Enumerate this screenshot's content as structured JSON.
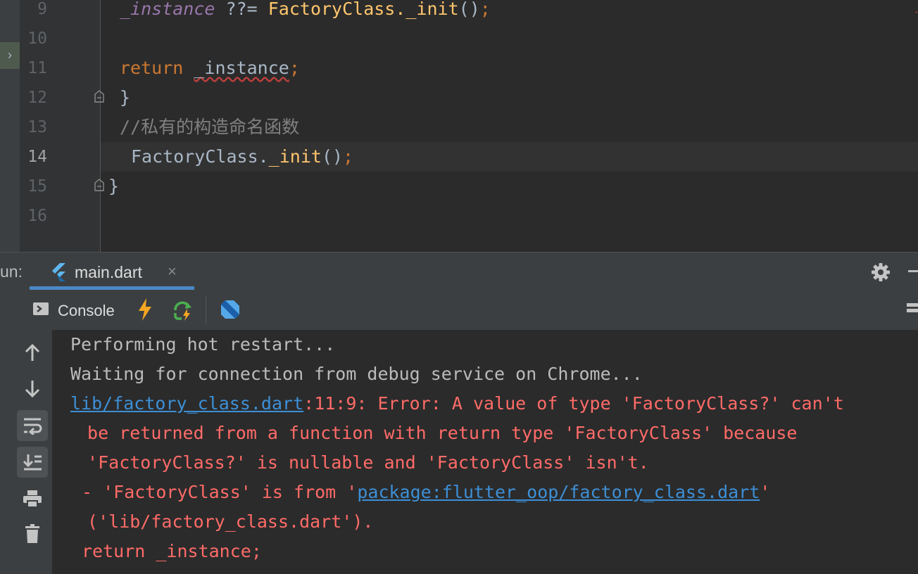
{
  "editor": {
    "lines": [
      {
        "number": "9",
        "tokens": [
          {
            "text": "_instance",
            "cls": "field"
          },
          {
            "text": " ??= ",
            "cls": "ident"
          },
          {
            "text": "FactoryClass._init",
            "cls": "cls"
          },
          {
            "text": "()",
            "cls": "punct"
          },
          {
            "text": ";",
            "cls": "semi"
          }
        ]
      },
      {
        "number": "10",
        "tokens": []
      },
      {
        "number": "11",
        "tokens": [
          {
            "text": "return ",
            "cls": "kw"
          },
          {
            "text": "_instance",
            "cls": "ident squiggle"
          },
          {
            "text": ";",
            "cls": "semi"
          }
        ]
      },
      {
        "number": "12",
        "tokens": [
          {
            "text": "}",
            "cls": "punct"
          }
        ]
      },
      {
        "number": "13",
        "tokens": [
          {
            "text": "//私有的构造命名函数",
            "cls": "comment"
          }
        ]
      },
      {
        "number": "14",
        "tokens": [
          {
            "text": "FactoryClass.",
            "cls": "ident"
          },
          {
            "text": "_init",
            "cls": "cls"
          },
          {
            "text": "()",
            "cls": "punct"
          },
          {
            "text": ";",
            "cls": "semi"
          }
        ]
      },
      {
        "number": "15",
        "tokens": [
          {
            "text": "}",
            "cls": "punct"
          }
        ]
      },
      {
        "number": "16",
        "tokens": []
      }
    ],
    "active_line": "14"
  },
  "run_panel": {
    "label": "un:",
    "tab_title": "main.dart",
    "tab_close": "×"
  },
  "console_toolbar": {
    "console_label": "Console"
  },
  "console": {
    "line1": "Performing hot restart...",
    "line2": "Waiting for connection from debug service on Chrome...",
    "error_link": "lib/factory_class.dart",
    "error_rest": ":11:9: Error: A value of type 'FactoryClass?' can't",
    "line4": " be returned from a function with return type 'FactoryClass' because",
    "line5": " 'FactoryClass?' is nullable and 'FactoryClass' isn't.",
    "line6_pre": "- 'FactoryClass' is from '",
    "line6_link": "package:flutter_oop/factory_class.dart",
    "line6_post": "'",
    "line7": " ('lib/factory_class.dart').",
    "line8": "return _instance;"
  },
  "colors": {
    "editor_bg": "#2b2b2b",
    "error_text": "#ff6b68",
    "link": "#3d8fd6",
    "keyword": "#cc7832",
    "method": "#ffc66d"
  }
}
